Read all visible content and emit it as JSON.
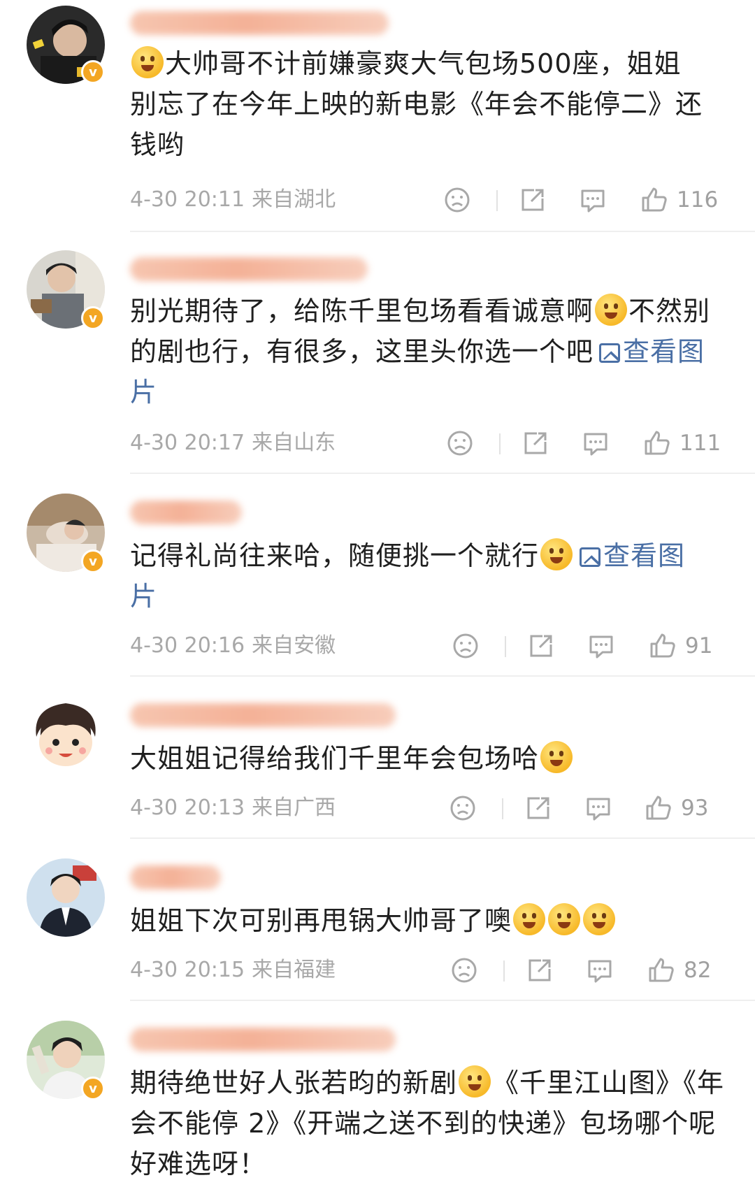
{
  "colors": {
    "link": "#4a6fa5",
    "meta": "#a8a8a8",
    "badge": "#f3a623"
  },
  "view_image_label": "查看图",
  "view_image_tail": "片",
  "comments": [
    {
      "avatar_icon": "user-avatar-icon",
      "verified_badge": "v",
      "text_lines": [
        "大帅哥不计前嫌豪爽大气包场500座，姐姐",
        "别忘了在今年上映的新电影《年会不能停二》还",
        "钱哟"
      ],
      "time": "4-30 20:11",
      "location": "来自湖北",
      "likes": "116"
    },
    {
      "avatar_icon": "user-avatar-icon",
      "verified_badge": "v",
      "text_lines": [
        "别光期待了，给陈千里包场看看诚意啊",
        "不然别",
        "的剧也行，有很多，这里头你选一个吧"
      ],
      "time": "4-30 20:17",
      "location": "来自山东",
      "likes": "111"
    },
    {
      "avatar_icon": "user-avatar-icon",
      "verified_badge": "v",
      "text_lines": [
        "记得礼尚往来哈，随便挑一个就行"
      ],
      "time": "4-30 20:16",
      "location": "来自安徽",
      "likes": "91"
    },
    {
      "avatar_icon": "cartoon-avatar-icon",
      "text_lines": [
        "大姐姐记得给我们千里年会包场哈"
      ],
      "time": "4-30 20:13",
      "location": "来自广西",
      "likes": "93"
    },
    {
      "avatar_icon": "user-avatar-icon",
      "text_lines": [
        "姐姐下次可别再甩锅大帅哥了噢"
      ],
      "time": "4-30 20:15",
      "location": "来自福建",
      "likes": "82"
    },
    {
      "avatar_icon": "user-avatar-icon",
      "verified_badge": "v",
      "text_lines": [
        "期待绝世好人张若昀的新剧",
        "《千里江山图》《年",
        "会不能停 2》《开端之送不到的快递》包场哪个呢",
        "好难选呀！"
      ]
    }
  ]
}
